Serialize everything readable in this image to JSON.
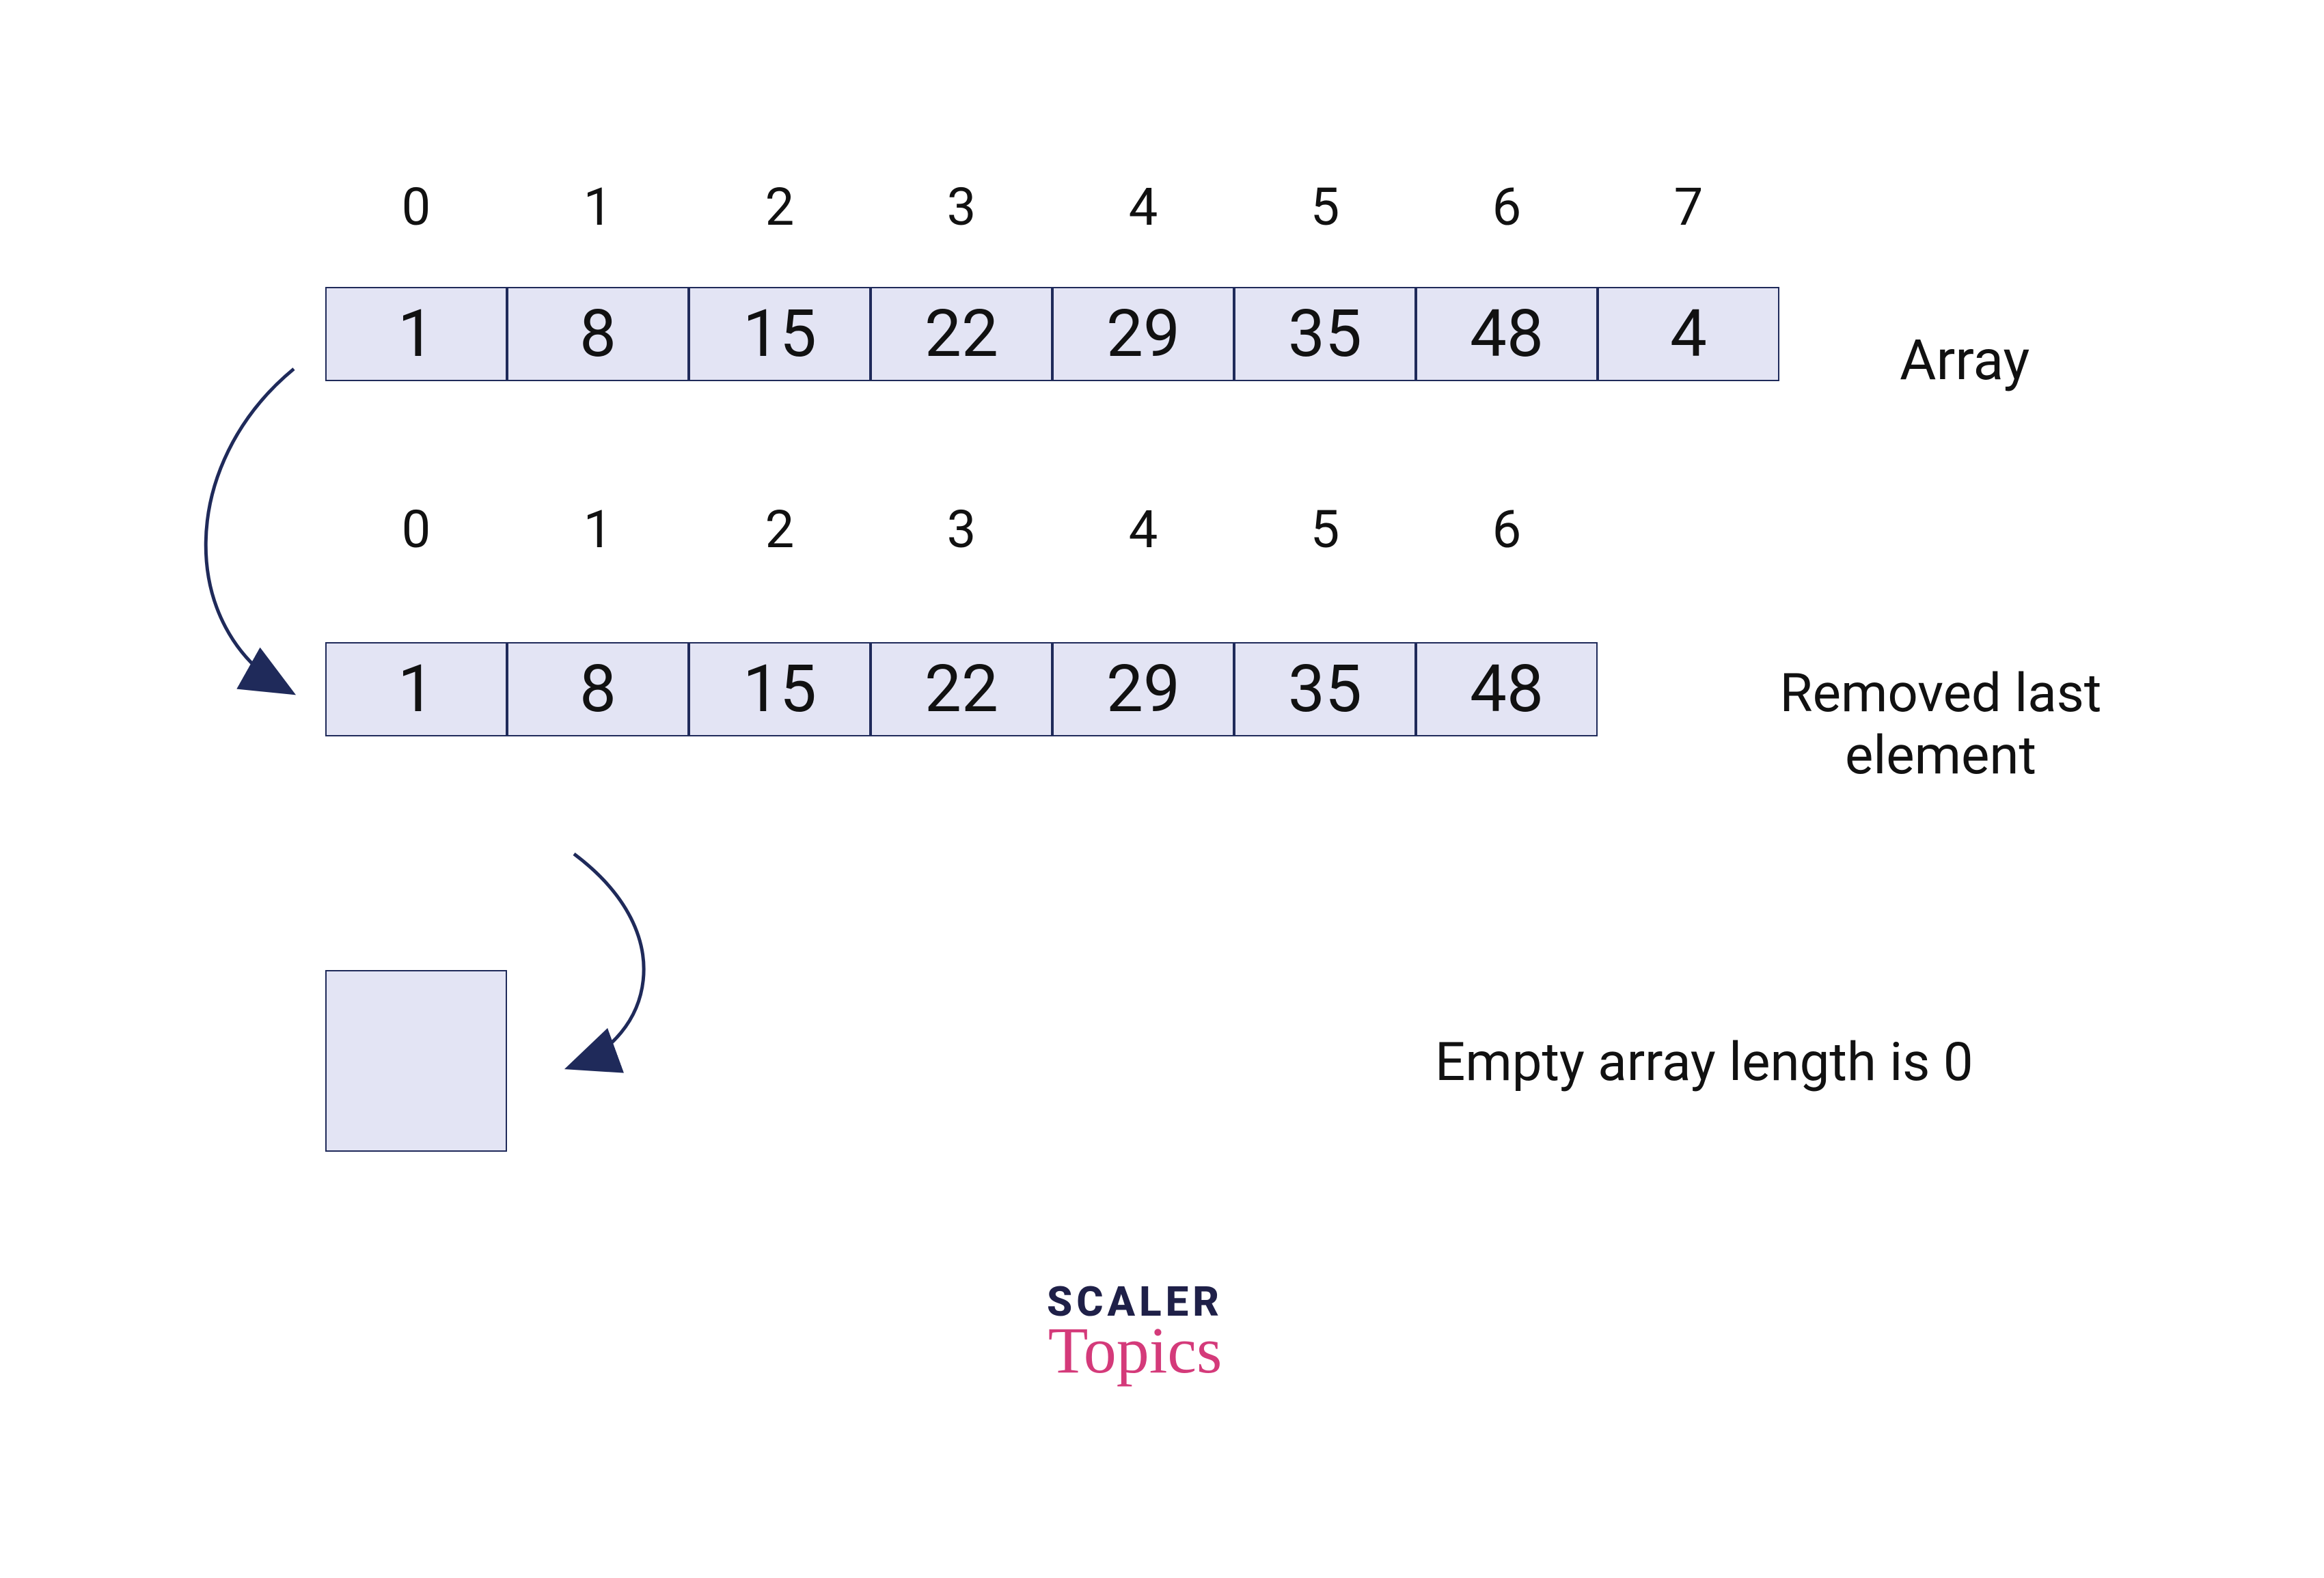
{
  "array1": {
    "indices": [
      "0",
      "1",
      "2",
      "3",
      "4",
      "5",
      "6",
      "7"
    ],
    "values": [
      "1",
      "8",
      "15",
      "22",
      "29",
      "35",
      "48",
      "4"
    ],
    "label": "Array"
  },
  "array2": {
    "indices": [
      "0",
      "1",
      "2",
      "3",
      "4",
      "5",
      "6"
    ],
    "values": [
      "1",
      "8",
      "15",
      "22",
      "29",
      "35",
      "48"
    ],
    "label": "Removed last element"
  },
  "array3": {
    "label": "Empty array length is 0"
  },
  "brand": {
    "line1": "SCALER",
    "line2": "Topics"
  }
}
